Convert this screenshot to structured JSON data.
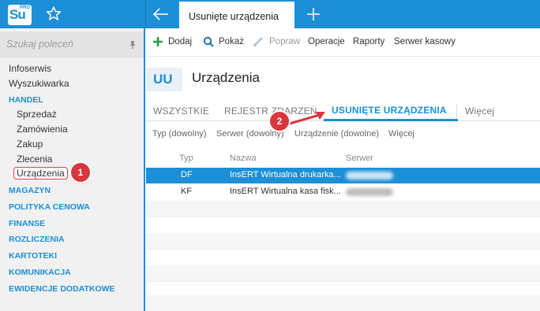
{
  "app": {
    "logo": "Su",
    "logo_badge": "PRO",
    "active_tab": "Usunięte urządzenia"
  },
  "sidebar": {
    "search_placeholder": "Szukaj poleceń",
    "items": [
      {
        "label": "Infoserwis"
      },
      {
        "label": "Wyszukiwarka"
      }
    ],
    "handel": {
      "label": "HANDEL",
      "children": [
        "Sprzedaż",
        "Zamówienia",
        "Zakup",
        "Zlecenia",
        "Urządzenia"
      ]
    },
    "sections": [
      "MAGAZYN",
      "POLITYKA CENOWA",
      "FINANSE",
      "ROZLICZENIA",
      "KARTOTEKI",
      "KOMUNIKACJA",
      "EWIDENCJE DODATKOWE"
    ]
  },
  "toolbar": {
    "add": "Dodaj",
    "show": "Pokaż",
    "edit": "Popraw",
    "operations": "Operacje",
    "reports": "Raporty",
    "cash_server": "Serwer kasowy"
  },
  "header": {
    "badge": "UU",
    "title": "Urządzenia"
  },
  "tabs": [
    "WSZYSTKIE",
    "REJESTR ZDARZEŃ",
    "USUNIĘTE URZĄDZENIA",
    "Więcej"
  ],
  "filters": [
    "Typ (dowolny)",
    "Serwer (dowolny)",
    "Urządzenie (dowolne)",
    "Więcej"
  ],
  "grid": {
    "columns": [
      "Typ",
      "Nazwa",
      "Serwer"
    ],
    "rows": [
      {
        "type": "DF",
        "name": "InsERT Wirtualna drukarka...",
        "selected": true
      },
      {
        "type": "KF",
        "name": "InsERT Wirtualna kasa fisk...",
        "selected": false
      }
    ]
  },
  "callouts": [
    "1",
    "2"
  ],
  "colors": {
    "accent": "#1c8fd6",
    "callout": "#d9363e"
  }
}
